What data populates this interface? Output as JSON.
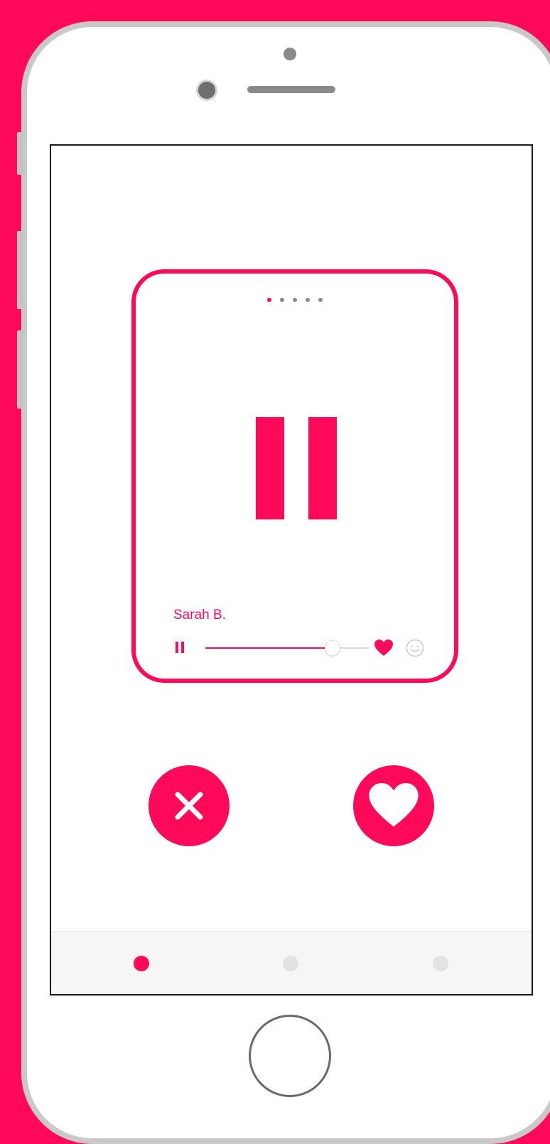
{
  "theme": {
    "accent": "#ff0a5a",
    "background": "#ff0a5a",
    "phone_frame": "#c9c9c9"
  },
  "card": {
    "pager_dots": 5,
    "active_page": 1,
    "name": "Sarah B.",
    "center_icon": "pause-icon",
    "player": {
      "play_state_icon": "pause-icon",
      "progress": 0.78,
      "like_icon": "heart-icon",
      "emoji_icon": "smiley-icon"
    }
  },
  "actions": [
    {
      "name": "dislike",
      "icon": "close-icon"
    },
    {
      "name": "like",
      "icon": "heart-icon"
    }
  ],
  "tabbar": {
    "tabs": 3,
    "active_tab": 1
  }
}
